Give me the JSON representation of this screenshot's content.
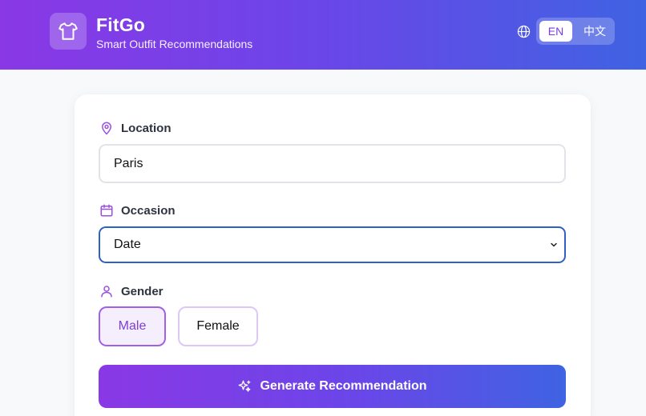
{
  "header": {
    "title": "FitGo",
    "subtitle": "Smart Outfit Recommendations",
    "logo_icon": "shirt-icon",
    "language": {
      "icon": "globe-icon",
      "options": [
        "EN",
        "中文"
      ],
      "selected": "EN"
    }
  },
  "form": {
    "location": {
      "label": "Location",
      "icon": "map-pin-icon",
      "value": "Paris"
    },
    "occasion": {
      "label": "Occasion",
      "icon": "calendar-icon",
      "value": "Date"
    },
    "gender": {
      "label": "Gender",
      "icon": "user-icon",
      "options": [
        "Male",
        "Female"
      ],
      "selected": "Male"
    },
    "generate_label": "Generate Recommendation"
  },
  "colors": {
    "accent_purple": "#8a38e6",
    "accent_blue": "#3f63e2",
    "focus_border": "#2f5fc8"
  }
}
